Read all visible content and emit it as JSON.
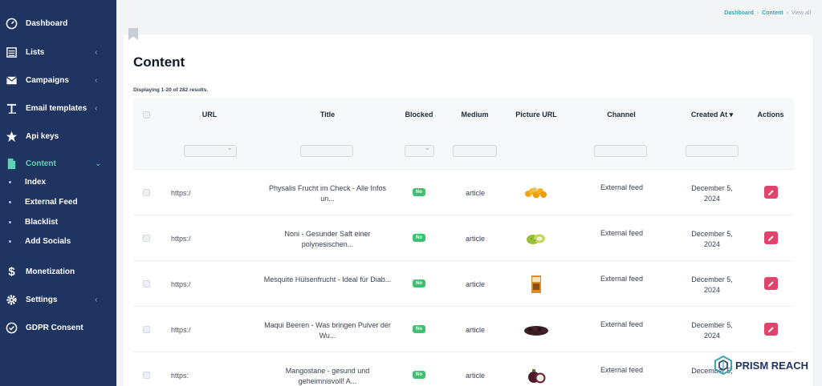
{
  "sidebar": {
    "items": [
      {
        "label": "Dashboard",
        "icon": "gauge-icon",
        "chevron": ""
      },
      {
        "label": "Lists",
        "icon": "list-icon",
        "chevron": "‹"
      },
      {
        "label": "Campaigns",
        "icon": "envelope-icon",
        "chevron": "‹"
      },
      {
        "label": "Email templates",
        "icon": "text-icon",
        "chevron": "‹"
      },
      {
        "label": "Api keys",
        "icon": "star-icon",
        "chevron": ""
      },
      {
        "label": "Content",
        "icon": "file-icon",
        "chevron": "⌄"
      },
      {
        "label": "Monetization",
        "icon": "dollar-icon",
        "chevron": ""
      },
      {
        "label": "Settings",
        "icon": "gear-icon",
        "chevron": "‹"
      },
      {
        "label": "GDPR Consent",
        "icon": "check-circle-icon",
        "chevron": ""
      }
    ],
    "sub_items": [
      {
        "label": "Index"
      },
      {
        "label": "External Feed"
      },
      {
        "label": "Blacklist"
      },
      {
        "label": "Add Socials"
      }
    ]
  },
  "breadcrumb": {
    "items": [
      "Dashboard",
      "Content"
    ],
    "current": "View all",
    "separator": "›"
  },
  "page": {
    "title": "Content",
    "results_text": "Displaying 1-20 of 282 results."
  },
  "table": {
    "headers": {
      "url": "URL",
      "title": "Title",
      "blocked": "Blocked",
      "medium": "Medium",
      "picture": "Picture URL",
      "channel": "Channel",
      "created": "Created At ▾",
      "actions": "Actions"
    },
    "rows": [
      {
        "url": "https:/",
        "title": "Physalis Frucht im Check - Alle Infos un...",
        "blocked": "No",
        "medium": "article",
        "picture": "physalis-image",
        "channel": "External feed",
        "date": "December 5, 2024"
      },
      {
        "url": "https:/",
        "title": "Noni - Gesunder Saft einer polynesischen...",
        "blocked": "No",
        "medium": "article",
        "picture": "noni-image",
        "channel": "External feed",
        "date": "December 5, 2024"
      },
      {
        "url": "https:/",
        "title": "Mesquite Hülsenfrucht - Ideal für Diab...",
        "blocked": "No",
        "medium": "article",
        "picture": "mesquite-image",
        "channel": "External feed",
        "date": "December 5, 2024"
      },
      {
        "url": "https:/",
        "title": "Maqui Beeren - Was bringen Pulver der Wu...",
        "blocked": "No",
        "medium": "article",
        "picture": "maqui-image",
        "channel": "External feed",
        "date": "December 5, 2024"
      },
      {
        "url": "https:",
        "title": "Mangostane - gesund und geheimnisvoll! A...",
        "blocked": "No",
        "medium": "article",
        "picture": "mangosteen-image",
        "channel": "External feed",
        "date": "December 5,"
      }
    ]
  },
  "brand": {
    "logo_text": "PRISM REACH"
  },
  "colors": {
    "sidebar": "#1f3461",
    "active": "#5fd3b4",
    "badge": "#3fbf6f",
    "action": "#e0446a"
  }
}
